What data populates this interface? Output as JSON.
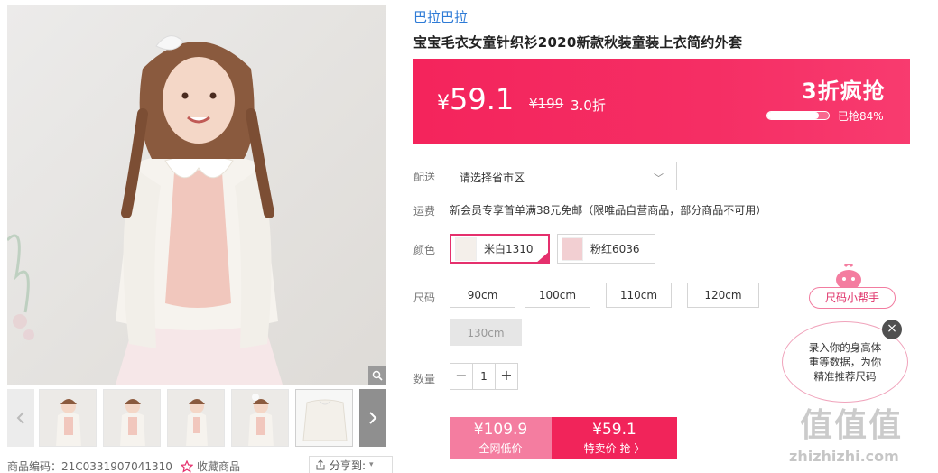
{
  "gallery": {
    "main_image_alt": "girl wearing white cardigan",
    "thumb_count": 5,
    "zoom_icon": "magnifier-icon"
  },
  "meta": {
    "product_code": "商品编码：21C0331907041310",
    "favorite_label": "收藏商品",
    "share_label": "分享到:"
  },
  "brand": "巴拉巴拉",
  "title": "宝宝毛衣女童针织衫2020新款秋装童装上衣简约外套",
  "price": {
    "symbol": "¥",
    "current": "59.1",
    "original": "¥199",
    "discount": "3.0折",
    "flash_label": "3折疯抢",
    "sold_percent": 0.84,
    "sold_text": "已抢84%"
  },
  "delivery": {
    "label": "配送",
    "placeholder": "请选择省市区"
  },
  "shipping": {
    "label": "运费",
    "text": "新会员专享首单满38元免邮（限唯品自营商品，部分商品不可用）"
  },
  "color": {
    "label": "颜色",
    "options": [
      {
        "name": "米白1310",
        "selected": true
      },
      {
        "name": "粉红6036",
        "selected": false
      }
    ]
  },
  "size": {
    "label": "尺码",
    "options": [
      "90cm",
      "100cm",
      "110cm",
      "120cm",
      "130cm"
    ],
    "disabled": [
      "130cm"
    ]
  },
  "quantity": {
    "label": "数量",
    "value": "1",
    "minus": "−",
    "plus": "+"
  },
  "buy": {
    "left_price": "¥109.9",
    "left_label": "全网低价",
    "right_price": "¥59.1",
    "right_label": "特卖价 抢 〉"
  },
  "helper": {
    "pill": "尺码小帮手",
    "bubble_line1": "录入你的身高体",
    "bubble_line2": "重等数据，为你",
    "bubble_line3": "精准推荐尺码",
    "close": "×"
  },
  "watermark": {
    "logo": "值值值",
    "text": "zhizhizhi.com"
  },
  "colors": {
    "accent": "#f4245c",
    "brand_link": "#2e7bd6",
    "helper_pink": "#e0336a"
  }
}
